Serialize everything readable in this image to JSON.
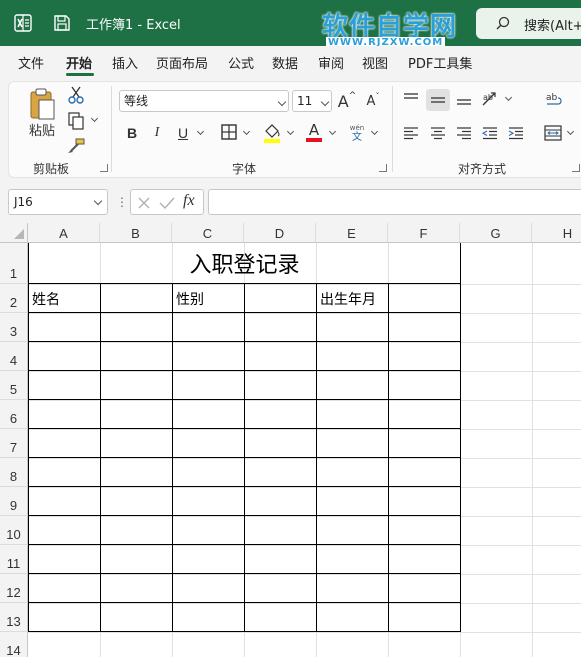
{
  "titlebar": {
    "title": "工作簿1  -  Excel",
    "watermark_cn": "软件自学网",
    "watermark_en": "WWW.RJZXW.COM",
    "search_label": "搜索(Alt+Q)"
  },
  "menu": {
    "tabs": [
      "文件",
      "开始",
      "插入",
      "页面布局",
      "公式",
      "数据",
      "审阅",
      "视图",
      "PDF工具集"
    ],
    "active": "开始"
  },
  "ribbon": {
    "clipboard": {
      "paste_label": "粘贴",
      "group_label": "剪贴板"
    },
    "font": {
      "font_name": "等线",
      "font_size": "11",
      "group_label": "字体",
      "bold": "B",
      "italic": "I",
      "underline": "U",
      "grow": "A",
      "shrink": "A",
      "font_color_letter": "A",
      "phonetic_top": "wén",
      "phonetic_bottom": "文"
    },
    "alignment": {
      "group_label": "对齐方式"
    },
    "colors": {
      "fill_color": "#ffff00",
      "font_color": "#e81123",
      "accent": "#1e7145"
    }
  },
  "formula_bar": {
    "cell_ref": "J16",
    "fx_label": "fx",
    "dots": "⋮",
    "formula": ""
  },
  "sheet": {
    "columns": [
      "A",
      "B",
      "C",
      "D",
      "E",
      "F",
      "G",
      "H"
    ],
    "rows": [
      "1",
      "2",
      "3",
      "4",
      "5",
      "6",
      "7",
      "8",
      "9",
      "10",
      "11",
      "12",
      "13",
      "14"
    ],
    "title": "入职登记录",
    "labels": {
      "name": "姓名",
      "gender": "性别",
      "birth": "出生年月"
    }
  }
}
